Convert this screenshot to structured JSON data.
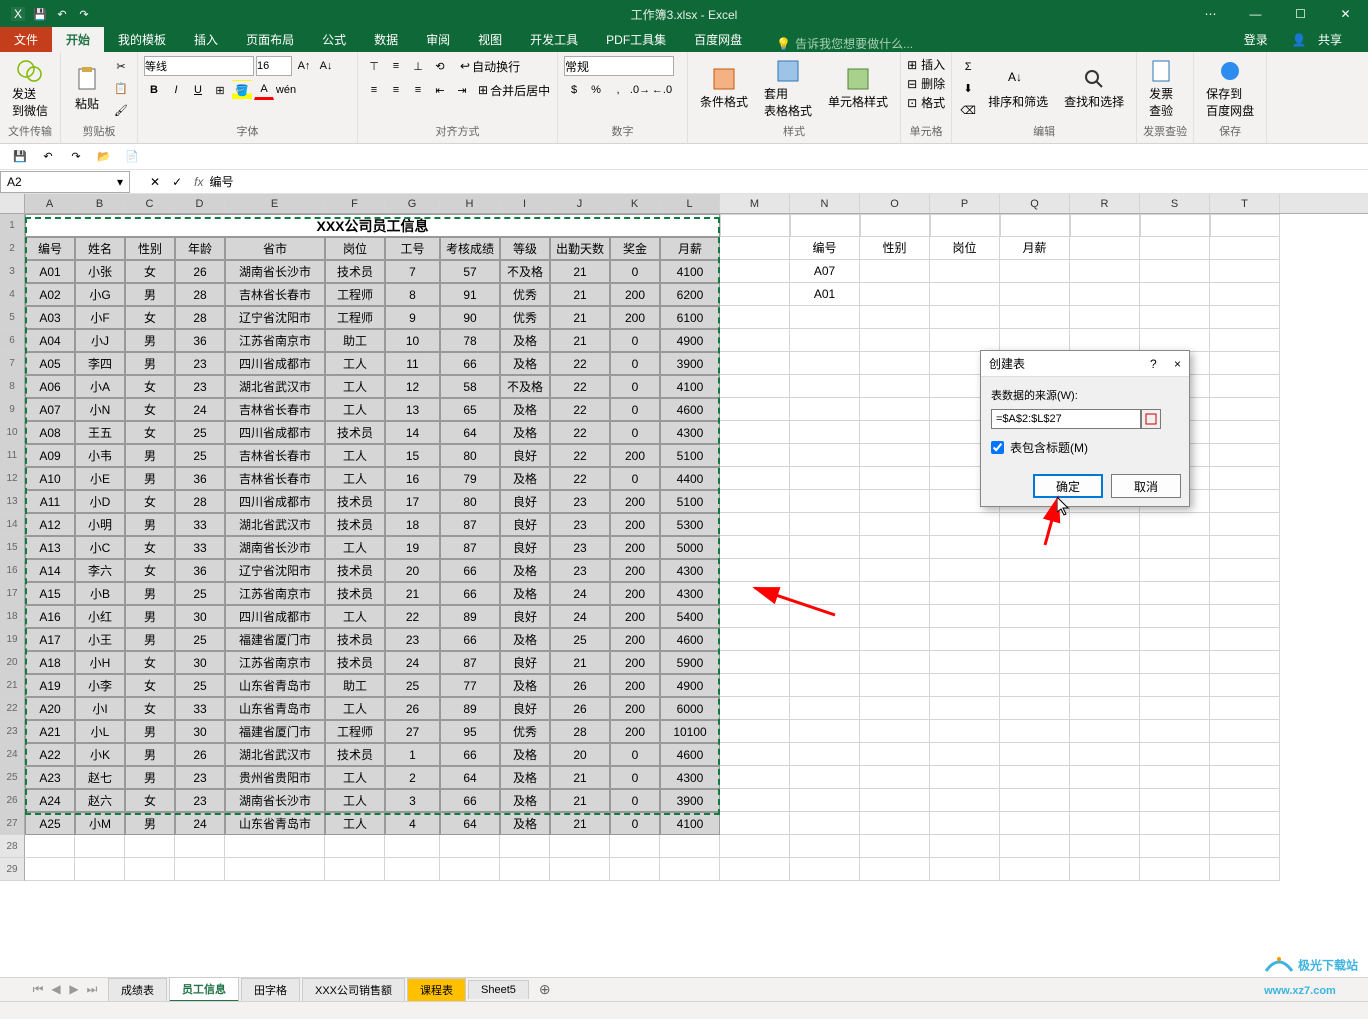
{
  "title": "工作簿3.xlsx - Excel",
  "tabs": {
    "file": "文件",
    "home": "开始",
    "templates": "我的模板",
    "insert": "插入",
    "layout": "页面布局",
    "formulas": "公式",
    "data": "数据",
    "review": "审阅",
    "view": "视图",
    "dev": "开发工具",
    "pdf": "PDF工具集",
    "baidu": "百度网盘",
    "tellme": "告诉我您想要做什么...",
    "login": "登录",
    "share": "共享"
  },
  "ribbon": {
    "wechat": {
      "send": "发送",
      "to": "到微信",
      "group": "文件传输"
    },
    "clipboard": {
      "paste": "粘贴",
      "group": "剪贴板"
    },
    "font": {
      "name": "等线",
      "size": "16",
      "group": "字体",
      "bold": "B",
      "italic": "I",
      "underline": "U"
    },
    "align": {
      "wrap": "自动换行",
      "merge": "合并后居中",
      "group": "对齐方式"
    },
    "number": {
      "general": "常规",
      "group": "数字"
    },
    "styles": {
      "cond": "条件格式",
      "table": "套用\n表格格式",
      "cellstyle": "单元格样式",
      "group": "样式"
    },
    "cells": {
      "insert": "插入",
      "delete": "删除",
      "format": "格式",
      "group": "单元格"
    },
    "editing": {
      "sort": "排序和筛选",
      "find": "查找和选择",
      "group": "编辑"
    },
    "invoice": {
      "btn": "发票\n查验",
      "group": "发票查验"
    },
    "save": {
      "btn": "保存到\n百度网盘",
      "group": "保存"
    }
  },
  "namebox": "A2",
  "formula": "编号",
  "colWidths": {
    "A": 50,
    "B": 50,
    "C": 50,
    "D": 50,
    "E": 100,
    "F": 60,
    "G": 55,
    "H": 60,
    "I": 50,
    "J": 60,
    "K": 50,
    "L": 60
  },
  "extraCols": [
    "M",
    "N",
    "O",
    "P",
    "Q",
    "R",
    "S",
    "T"
  ],
  "extraColWidth": 70,
  "tableTitle": "XXX公司员工信息",
  "headers": [
    "编号",
    "姓名",
    "性别",
    "年龄",
    "省市",
    "岗位",
    "工号",
    "考核成绩",
    "等级",
    "出勤天数",
    "奖金",
    "月薪"
  ],
  "rows": [
    [
      "A01",
      "小张",
      "女",
      "26",
      "湖南省长沙市",
      "技术员",
      "7",
      "57",
      "不及格",
      "21",
      "0",
      "4100"
    ],
    [
      "A02",
      "小G",
      "男",
      "28",
      "吉林省长春市",
      "工程师",
      "8",
      "91",
      "优秀",
      "21",
      "200",
      "6200"
    ],
    [
      "A03",
      "小F",
      "女",
      "28",
      "辽宁省沈阳市",
      "工程师",
      "9",
      "90",
      "优秀",
      "21",
      "200",
      "6100"
    ],
    [
      "A04",
      "小J",
      "男",
      "36",
      "江苏省南京市",
      "助工",
      "10",
      "78",
      "及格",
      "21",
      "0",
      "4900"
    ],
    [
      "A05",
      "李四",
      "男",
      "23",
      "四川省成都市",
      "工人",
      "11",
      "66",
      "及格",
      "22",
      "0",
      "3900"
    ],
    [
      "A06",
      "小A",
      "女",
      "23",
      "湖北省武汉市",
      "工人",
      "12",
      "58",
      "不及格",
      "22",
      "0",
      "4100"
    ],
    [
      "A07",
      "小N",
      "女",
      "24",
      "吉林省长春市",
      "工人",
      "13",
      "65",
      "及格",
      "22",
      "0",
      "4600"
    ],
    [
      "A08",
      "王五",
      "女",
      "25",
      "四川省成都市",
      "技术员",
      "14",
      "64",
      "及格",
      "22",
      "0",
      "4300"
    ],
    [
      "A09",
      "小韦",
      "男",
      "25",
      "吉林省长春市",
      "工人",
      "15",
      "80",
      "良好",
      "22",
      "200",
      "5100"
    ],
    [
      "A10",
      "小E",
      "男",
      "36",
      "吉林省长春市",
      "工人",
      "16",
      "79",
      "及格",
      "22",
      "0",
      "4400"
    ],
    [
      "A11",
      "小D",
      "女",
      "28",
      "四川省成都市",
      "技术员",
      "17",
      "80",
      "良好",
      "23",
      "200",
      "5100"
    ],
    [
      "A12",
      "小明",
      "男",
      "33",
      "湖北省武汉市",
      "技术员",
      "18",
      "87",
      "良好",
      "23",
      "200",
      "5300"
    ],
    [
      "A13",
      "小C",
      "女",
      "33",
      "湖南省长沙市",
      "工人",
      "19",
      "87",
      "良好",
      "23",
      "200",
      "5000"
    ],
    [
      "A14",
      "李六",
      "女",
      "36",
      "辽宁省沈阳市",
      "技术员",
      "20",
      "66",
      "及格",
      "23",
      "200",
      "4300"
    ],
    [
      "A15",
      "小B",
      "男",
      "25",
      "江苏省南京市",
      "技术员",
      "21",
      "66",
      "及格",
      "24",
      "200",
      "4300"
    ],
    [
      "A16",
      "小红",
      "男",
      "30",
      "四川省成都市",
      "工人",
      "22",
      "89",
      "良好",
      "24",
      "200",
      "5400"
    ],
    [
      "A17",
      "小王",
      "男",
      "25",
      "福建省厦门市",
      "技术员",
      "23",
      "66",
      "及格",
      "25",
      "200",
      "4600"
    ],
    [
      "A18",
      "小H",
      "女",
      "30",
      "江苏省南京市",
      "技术员",
      "24",
      "87",
      "良好",
      "21",
      "200",
      "5900"
    ],
    [
      "A19",
      "小李",
      "女",
      "25",
      "山东省青岛市",
      "助工",
      "25",
      "77",
      "及格",
      "26",
      "200",
      "4900"
    ],
    [
      "A20",
      "小I",
      "女",
      "33",
      "山东省青岛市",
      "工人",
      "26",
      "89",
      "良好",
      "26",
      "200",
      "6000"
    ],
    [
      "A21",
      "小L",
      "男",
      "30",
      "福建省厦门市",
      "工程师",
      "27",
      "95",
      "优秀",
      "28",
      "200",
      "10100"
    ],
    [
      "A22",
      "小K",
      "男",
      "26",
      "湖北省武汉市",
      "技术员",
      "1",
      "66",
      "及格",
      "20",
      "0",
      "4600"
    ],
    [
      "A23",
      "赵七",
      "男",
      "23",
      "贵州省贵阳市",
      "工人",
      "2",
      "64",
      "及格",
      "21",
      "0",
      "4300"
    ],
    [
      "A24",
      "赵六",
      "女",
      "23",
      "湖南省长沙市",
      "工人",
      "3",
      "66",
      "及格",
      "21",
      "0",
      "3900"
    ],
    [
      "A25",
      "小M",
      "男",
      "24",
      "山东省青岛市",
      "工人",
      "4",
      "64",
      "及格",
      "21",
      "0",
      "4100"
    ]
  ],
  "sideHeaders": [
    "编号",
    "性别",
    "岗位",
    "月薪"
  ],
  "sideData": [
    "A07",
    "A01"
  ],
  "dialog": {
    "title": "创建表",
    "help": "?",
    "close": "×",
    "sourceLabel": "表数据的来源(W):",
    "range": "=$A$2:$L$27",
    "headersChk": "表包含标题(M)",
    "ok": "确定",
    "cancel": "取消"
  },
  "sheetTabs": {
    "s1": "成绩表",
    "s2": "员工信息",
    "s3": "田字格",
    "s4": "XXX公司销售额",
    "s5": "课程表",
    "s6": "Sheet5"
  },
  "watermark": {
    "text1": "极光下载站",
    "text2": "www.xz7.com"
  }
}
